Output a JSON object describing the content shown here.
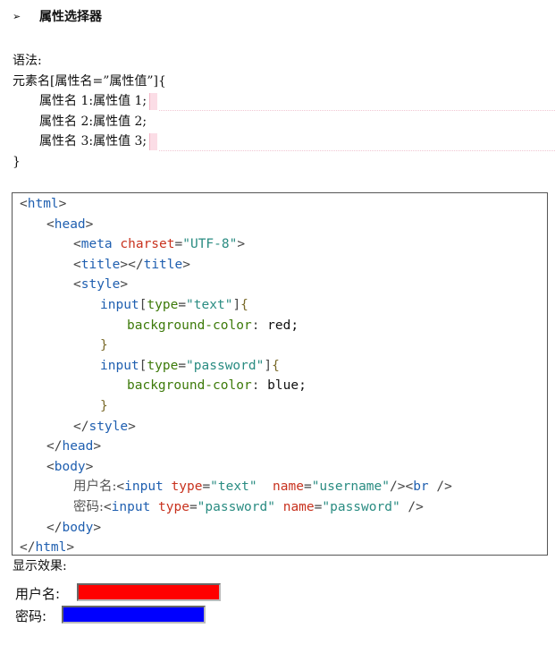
{
  "heading": {
    "bullet": "➢",
    "title": "属性选择器"
  },
  "syntax": {
    "label": "语法:",
    "open": "元素名[属性名=”属性值”]{",
    "rules": [
      "属性名 1:属性值 1;",
      "属性名 2:属性值 2;",
      "属性名 3:属性值 3;"
    ],
    "close": "}"
  },
  "code_lines": [
    {
      "indent": 0,
      "tokens": [
        [
          "<",
          "p"
        ],
        [
          "html",
          "t"
        ],
        [
          ">",
          "p"
        ]
      ]
    },
    {
      "indent": 1,
      "tokens": [
        [
          "<",
          "p"
        ],
        [
          "head",
          "t"
        ],
        [
          ">",
          "p"
        ]
      ]
    },
    {
      "indent": 2,
      "tokens": [
        [
          "<",
          "p"
        ],
        [
          "meta",
          "t"
        ],
        [
          " ",
          "p"
        ],
        [
          "charset",
          "a"
        ],
        [
          "=",
          "p"
        ],
        [
          "\"UTF-8\"",
          "v"
        ],
        [
          ">",
          "p"
        ]
      ]
    },
    {
      "indent": 2,
      "tokens": [
        [
          "<",
          "p"
        ],
        [
          "title",
          "t"
        ],
        [
          "></",
          "p"
        ],
        [
          "title",
          "t"
        ],
        [
          ">",
          "p"
        ]
      ]
    },
    {
      "indent": 2,
      "tokens": [
        [
          "<",
          "p"
        ],
        [
          "style",
          "t"
        ],
        [
          ">",
          "p"
        ]
      ]
    },
    {
      "indent": 3,
      "tokens": [
        [
          "input",
          "t"
        ],
        [
          "[",
          "p"
        ],
        [
          "type",
          "c"
        ],
        [
          "=",
          "p"
        ],
        [
          "\"text\"",
          "v"
        ],
        [
          "]",
          "p"
        ],
        [
          "{",
          "b"
        ]
      ]
    },
    {
      "indent": 4,
      "tokens": [
        [
          "background-color",
          "c"
        ],
        [
          ": ",
          "p"
        ],
        [
          "red;",
          "k"
        ]
      ]
    },
    {
      "indent": 3,
      "tokens": [
        [
          "}",
          "b"
        ]
      ]
    },
    {
      "indent": 3,
      "tokens": [
        [
          "input",
          "t"
        ],
        [
          "[",
          "p"
        ],
        [
          "type",
          "c"
        ],
        [
          "=",
          "p"
        ],
        [
          "\"password\"",
          "v"
        ],
        [
          "]",
          "p"
        ],
        [
          "{",
          "b"
        ]
      ]
    },
    {
      "indent": 4,
      "tokens": [
        [
          "background-color",
          "c"
        ],
        [
          ": ",
          "p"
        ],
        [
          "blue;",
          "k"
        ]
      ]
    },
    {
      "indent": 3,
      "tokens": [
        [
          "}",
          "b"
        ]
      ]
    },
    {
      "indent": 2,
      "tokens": [
        [
          "</",
          "p"
        ],
        [
          "style",
          "t"
        ],
        [
          ">",
          "p"
        ]
      ]
    },
    {
      "indent": 1,
      "tokens": [
        [
          "</",
          "p"
        ],
        [
          "head",
          "t"
        ],
        [
          ">",
          "p"
        ]
      ]
    },
    {
      "indent": 1,
      "tokens": [
        [
          "<",
          "p"
        ],
        [
          "body",
          "t"
        ],
        [
          ">",
          "p"
        ]
      ]
    },
    {
      "indent": 2,
      "tokens": [
        [
          "用户名:",
          "z"
        ],
        [
          "<",
          "p"
        ],
        [
          "input",
          "t"
        ],
        [
          " ",
          "p"
        ],
        [
          "type",
          "a"
        ],
        [
          "=",
          "p"
        ],
        [
          "\"text\"",
          "v"
        ],
        [
          "  ",
          "p"
        ],
        [
          "name",
          "a"
        ],
        [
          "=",
          "p"
        ],
        [
          "\"username\"",
          "v"
        ],
        [
          "/><",
          "p"
        ],
        [
          "br",
          "t"
        ],
        [
          " />",
          "p"
        ]
      ]
    },
    {
      "indent": 2,
      "tokens": [
        [
          "密码:",
          "z"
        ],
        [
          "<",
          "p"
        ],
        [
          "input",
          "t"
        ],
        [
          " ",
          "p"
        ],
        [
          "type",
          "a"
        ],
        [
          "=",
          "p"
        ],
        [
          "\"password\"",
          "v"
        ],
        [
          " ",
          "p"
        ],
        [
          "name",
          "a"
        ],
        [
          "=",
          "p"
        ],
        [
          "\"password\"",
          "v"
        ],
        [
          " />",
          "p"
        ]
      ]
    },
    {
      "indent": 1,
      "tokens": [
        [
          "</",
          "p"
        ],
        [
          "body",
          "t"
        ],
        [
          ">",
          "p"
        ]
      ]
    },
    {
      "indent": 0,
      "tokens": [
        [
          "</",
          "p"
        ],
        [
          "html",
          "t"
        ],
        [
          ">",
          "p"
        ]
      ]
    }
  ],
  "demo": {
    "label": "显示效果:",
    "username_label": "用户名:",
    "password_label": "密码:",
    "username_bg": "#ff0000",
    "password_bg": "#0000ff"
  }
}
